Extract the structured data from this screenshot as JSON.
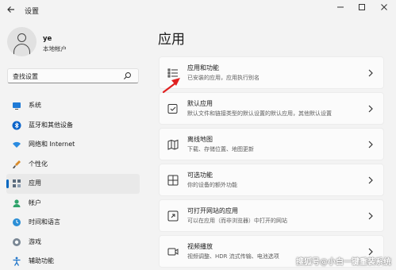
{
  "window": {
    "title": "设置",
    "back_icon": "back-arrow-icon",
    "controls": [
      "minimize-icon",
      "maximize-icon",
      "close-icon"
    ]
  },
  "user": {
    "name": "ye",
    "account_type": "本地帐户"
  },
  "search": {
    "placeholder": "查找设置"
  },
  "sidebar": {
    "items": [
      {
        "label": "系统",
        "icon": "monitor-icon"
      },
      {
        "label": "蓝牙和其他设备",
        "icon": "bluetooth-icon"
      },
      {
        "label": "网络和 Internet",
        "icon": "wifi-icon"
      },
      {
        "label": "个性化",
        "icon": "brush-icon"
      },
      {
        "label": "应用",
        "icon": "apps-icon",
        "selected": true
      },
      {
        "label": "帐户",
        "icon": "account-icon"
      },
      {
        "label": "时间和语言",
        "icon": "globe-clock-icon"
      },
      {
        "label": "游戏",
        "icon": "gamepad-icon"
      },
      {
        "label": "辅助功能",
        "icon": "accessibility-icon"
      }
    ]
  },
  "main": {
    "title": "应用",
    "cards": [
      {
        "title": "应用和功能",
        "subtitle": "已安装的应用，应用执行别名",
        "icon": "list-icon"
      },
      {
        "title": "默认应用",
        "subtitle": "默认文件和链接类型的默认设置的默认应用，其他默认设置",
        "icon": "default-apps-icon"
      },
      {
        "title": "离线地图",
        "subtitle": "下载、存储位置、地图更新",
        "icon": "map-icon"
      },
      {
        "title": "可选功能",
        "subtitle": "你的设备的额外功能",
        "icon": "optional-features-icon"
      },
      {
        "title": "可打开网站的应用",
        "subtitle": "可以在应用（而非浏览器）中打开的网站",
        "icon": "open-link-icon"
      },
      {
        "title": "视频播放",
        "subtitle": "视频调整、HDR 流式传输、电池选项",
        "icon": "video-icon"
      }
    ]
  },
  "annotation": {
    "icon": "red-arrow-icon",
    "color": "#e02020"
  },
  "watermark": "搜狐号@小白一键重装系统",
  "colors": {
    "accent": "#0067c0",
    "background": "#f3f3f3",
    "card": "#fbfbfb"
  }
}
